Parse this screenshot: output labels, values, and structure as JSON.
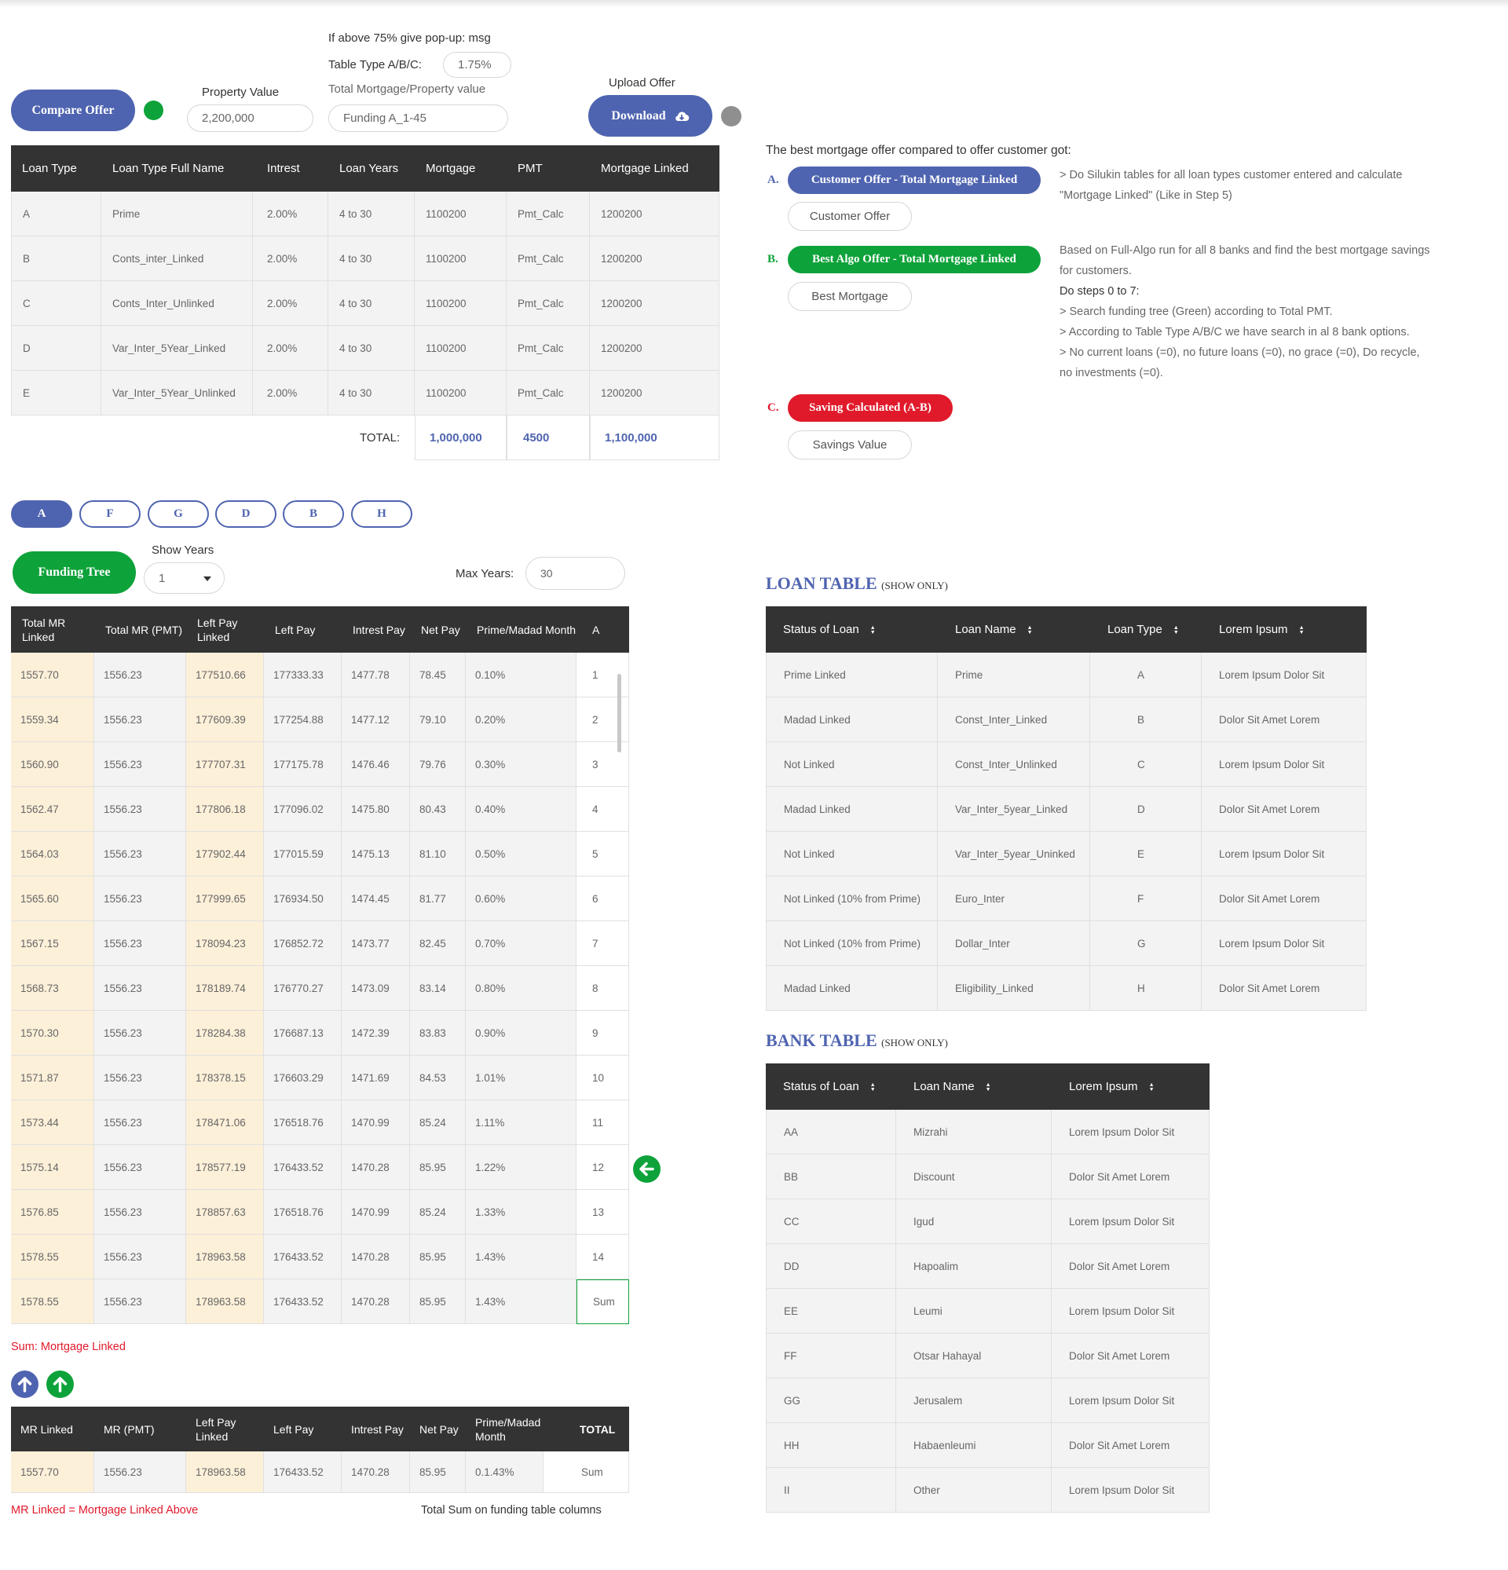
{
  "top": {
    "popup_note": "If above 75% give pop-up: msg",
    "table_type_label": "Table Type A/B/C:",
    "table_type_value": "1.75%",
    "total_ratio_label": "Total Mortgage/Property value",
    "funding_value": "Funding A_1-45",
    "property_label": "Property Value",
    "property_value": "2,200,000",
    "compare_btn": "Compare Offer",
    "upload_label": "Upload Offer",
    "download_btn": "Download"
  },
  "loan_main": {
    "headers": [
      "Loan Type",
      "Loan Type Full Name",
      "Intrest",
      "Loan Years",
      "Mortgage",
      "PMT",
      "Mortgage Linked"
    ],
    "rows": [
      [
        "A",
        "Prime",
        "2.00%",
        "4 to 30",
        "1100200",
        "Pmt_Calc",
        "1200200"
      ],
      [
        "B",
        "Conts_inter_Linked",
        "2.00%",
        "4 to 30",
        "1100200",
        "Pmt_Calc",
        "1200200"
      ],
      [
        "C",
        "Conts_Inter_Unlinked",
        "2.00%",
        "4 to 30",
        "1100200",
        "Pmt_Calc",
        "1200200"
      ],
      [
        "D",
        "Var_Inter_5Year_Linked",
        "2.00%",
        "4 to 30",
        "1100200",
        "Pmt_Calc",
        "1200200"
      ],
      [
        "E",
        "Var_Inter_5Year_Unlinked",
        "2.00%",
        "4 to 30",
        "1100200",
        "Pmt_Calc",
        "1200200"
      ]
    ],
    "total_label": "TOTAL:",
    "total_mortgage": "1,000,000",
    "total_pmt": "4500",
    "total_linked": "1,100,000"
  },
  "offer": {
    "intro": "The best mortgage offer compared to offer customer got:",
    "a_letter": "A.",
    "a_btn": "Customer Offer - Total Mortgage Linked",
    "a_field": "Customer Offer",
    "a_note1": "> Do Silukin tables for all loan types customer entered and calculate",
    "a_note2": "\"Mortgage Linked\" (Like in Step 5)",
    "b_letter": "B.",
    "b_btn": "Best Algo Offer - Total Mortgage Linked",
    "b_field": "Best Mortgage",
    "b_note1": "Based on Full-Algo run for all 8 banks and find the best mortgage savings",
    "b_note2": "for customers.",
    "b_note3": "Do steps 0 to 7:",
    "b_note4": "> Search funding tree (Green) according to Total PMT.",
    "b_note5": "> According to Table Type A/B/C we have search in al 8 bank options.",
    "b_note6": "> No current loans (=0), no future loans (=0), no grace (=0), Do recycle,",
    "b_note7": "no investments (=0).",
    "c_letter": "C.",
    "c_btn": "Saving Calculated (A-B)",
    "c_field": "Savings Value"
  },
  "tabs": [
    "A",
    "F",
    "G",
    "D",
    "B",
    "H"
  ],
  "funding": {
    "btn": "Funding Tree",
    "show_years_label": "Show Years",
    "show_years_value": "1",
    "max_years_label": "Max Years:",
    "max_years_value": "30",
    "headers": [
      "Total MR Linked",
      "Total MR (PMT)",
      "Left Pay Linked",
      "Left Pay",
      "Intrest Pay",
      "Net Pay",
      "Prime/Madad Month",
      "A"
    ],
    "rows": [
      [
        "1557.70",
        "1556.23",
        "177510.66",
        "177333.33",
        "1477.78",
        "78.45",
        "0.10%",
        "1"
      ],
      [
        "1559.34",
        "1556.23",
        "177609.39",
        "177254.88",
        "1477.12",
        "79.10",
        "0.20%",
        "2"
      ],
      [
        "1560.90",
        "1556.23",
        "177707.31",
        "177175.78",
        "1476.46",
        "79.76",
        "0.30%",
        "3"
      ],
      [
        "1562.47",
        "1556.23",
        "177806.18",
        "177096.02",
        "1475.80",
        "80.43",
        "0.40%",
        "4"
      ],
      [
        "1564.03",
        "1556.23",
        "177902.44",
        "177015.59",
        "1475.13",
        "81.10",
        "0.50%",
        "5"
      ],
      [
        "1565.60",
        "1556.23",
        "177999.65",
        "176934.50",
        "1474.45",
        "81.77",
        "0.60%",
        "6"
      ],
      [
        "1567.15",
        "1556.23",
        "178094.23",
        "176852.72",
        "1473.77",
        "82.45",
        "0.70%",
        "7"
      ],
      [
        "1568.73",
        "1556.23",
        "178189.74",
        "176770.27",
        "1473.09",
        "83.14",
        "0.80%",
        "8"
      ],
      [
        "1570.30",
        "1556.23",
        "178284.38",
        "176687.13",
        "1472.39",
        "83.83",
        "0.90%",
        "9"
      ],
      [
        "1571.87",
        "1556.23",
        "178378.15",
        "176603.29",
        "1471.69",
        "84.53",
        "1.01%",
        "10"
      ],
      [
        "1573.44",
        "1556.23",
        "178471.06",
        "176518.76",
        "1470.99",
        "85.24",
        "1.11%",
        "11"
      ],
      [
        "1575.14",
        "1556.23",
        "178577.19",
        "176433.52",
        "1470.28",
        "85.95",
        "1.22%",
        "12"
      ],
      [
        "1576.85",
        "1556.23",
        "178857.63",
        "176518.76",
        "1470.99",
        "85.24",
        "1.33%",
        "13"
      ],
      [
        "1578.55",
        "1556.23",
        "178963.58",
        "176433.52",
        "1470.28",
        "85.95",
        "1.43%",
        "14"
      ],
      [
        "1578.55",
        "1556.23",
        "178963.58",
        "176433.52",
        "1470.28",
        "85.95",
        "1.43%",
        "Sum"
      ]
    ],
    "sum_note": "Sum: Mortgage Linked"
  },
  "summary": {
    "headers": [
      "MR Linked",
      "MR (PMT)",
      "Left Pay Linked",
      "Left Pay",
      "Intrest Pay",
      "Net Pay",
      "Prime/Madad Month",
      "TOTAL"
    ],
    "row": [
      "1557.70",
      "1556.23",
      "178963.58",
      "176433.52",
      "1470.28",
      "85.95",
      "0.1.43%",
      "Sum"
    ],
    "note_left": "MR Linked = Mortgage Linked Above",
    "note_right": "Total Sum on funding table columns"
  },
  "loan_table": {
    "title": "LOAN TABLE",
    "subtitle": "(SHOW ONLY)",
    "headers": [
      "Status of Loan",
      "Loan Name",
      "Loan Type",
      "Lorem Ipsum"
    ],
    "rows": [
      [
        "Prime Linked",
        "Prime",
        "A",
        "Lorem Ipsum Dolor Sit"
      ],
      [
        "Madad Linked",
        "Const_Inter_Linked",
        "B",
        "Dolor Sit Amet Lorem"
      ],
      [
        "Not Linked",
        "Const_Inter_Unlinked",
        "C",
        "Lorem Ipsum Dolor Sit"
      ],
      [
        "Madad Linked",
        "Var_Inter_5year_Linked",
        "D",
        "Dolor Sit Amet Lorem"
      ],
      [
        "Not Linked",
        "Var_Inter_5year_Uninked",
        "E",
        "Lorem Ipsum Dolor Sit"
      ],
      [
        "Not Linked (10% from Prime)",
        "Euro_Inter",
        "F",
        "Dolor Sit Amet Lorem"
      ],
      [
        "Not Linked (10% from Prime)",
        "Dollar_Inter",
        "G",
        "Lorem Ipsum Dolor Sit"
      ],
      [
        "Madad Linked",
        "Eligibility_Linked",
        "H",
        "Dolor Sit Amet Lorem"
      ]
    ]
  },
  "bank_table": {
    "title": "BANK TABLE",
    "subtitle": "(SHOW ONLY)",
    "headers": [
      "Status of Loan",
      "Loan Name",
      "Lorem Ipsum"
    ],
    "rows": [
      [
        "AA",
        "Mizrahi",
        "Lorem Ipsum Dolor Sit"
      ],
      [
        "BB",
        "Discount",
        "Dolor Sit Amet Lorem"
      ],
      [
        "CC",
        "Igud",
        "Lorem Ipsum Dolor Sit"
      ],
      [
        "DD",
        "Hapoalim",
        "Dolor Sit Amet Lorem"
      ],
      [
        "EE",
        "Leumi",
        "Lorem Ipsum Dolor Sit"
      ],
      [
        "FF",
        "Otsar Hahayal",
        "Dolor Sit Amet Lorem"
      ],
      [
        "GG",
        "Jerusalem",
        "Lorem Ipsum Dolor Sit"
      ],
      [
        "HH",
        "Habaenleumi",
        "Dolor Sit Amet Lorem"
      ],
      [
        "II",
        "Other",
        "Lorem Ipsum Dolor Sit"
      ]
    ]
  },
  "colors": {
    "accent_blue": "#4f64b0",
    "green": "#0ea23a",
    "red": "#e01a2b",
    "header_dark": "#333333",
    "cream": "#fdf0d9"
  }
}
